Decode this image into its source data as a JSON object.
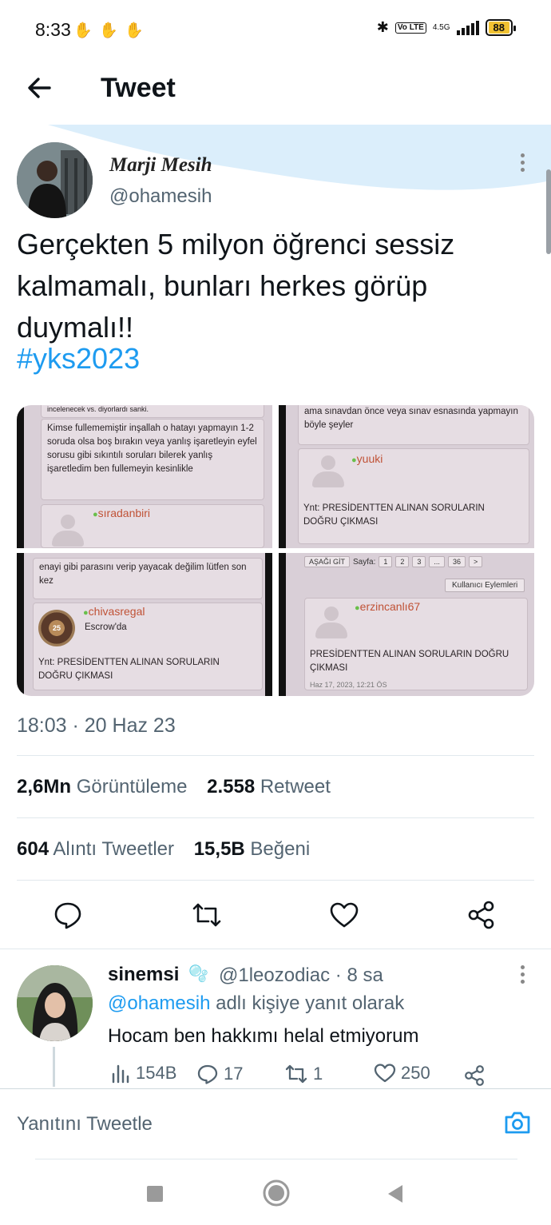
{
  "status_bar": {
    "time": "8:33",
    "network": "4.5G",
    "battery": "88",
    "volte": "Vo LTE"
  },
  "header": {
    "title": "Tweet"
  },
  "tweet": {
    "display_name": "Marji Mesih",
    "handle": "@ohamesih",
    "text": "Gerçekten 5 milyon öğrenci sessiz kalmamalı, bunları herkes görüp duymalı!!",
    "hashtag": "#yks2023",
    "timestamp": "18:03 · 20 Haz 23",
    "views_count": "2,6Mn",
    "views_label": "Görüntüleme",
    "retweets_count": "2.558",
    "retweets_label": "Retweet",
    "quotes_count": "604",
    "quotes_label": "Alıntı Tweetler",
    "likes_count": "15,5B",
    "likes_label": "Beğeni"
  },
  "media": {
    "tile1": {
      "top_text": "incelenecek vs. diyorlardı sanki.",
      "body": "Kimse fullememiştir inşallah o hatayı yapmayın 1-2 soruda olsa boş bırakın veya yanlış işaretleyin eyfel sorusu gibi sıkıntılı soruları bilerek yanlış işaretledim ben fullemeyin kesinlikle",
      "user": "sıradanbiri"
    },
    "tile2": {
      "body": "ama sınavdan önce veya sınav esnasında yapmayın böyle şeyler",
      "user": "yuuki",
      "reply": "Ynt: PRESİDENTTEN ALINAN SORULARIN DOĞRU ÇIKMASI"
    },
    "tile3": {
      "body": "enayi gibi parasını verip yayacak değilim lütfen son kez",
      "user": "chivasregal",
      "sub": "Escrow'da",
      "badge": "25",
      "reply": "Ynt: PRESİDENTTEN ALINAN SORULARIN DOĞRU ÇIKMASI"
    },
    "tile4": {
      "goto": "AŞAĞI GİT",
      "page_label": "Sayfa:",
      "pages": [
        "1",
        "2",
        "3",
        "...",
        "36",
        ">"
      ],
      "actions": "Kullanıcı Eylemleri",
      "user": "erzincanlı67",
      "title": "PRESİDENTTEN ALINAN SORULARIN DOĞRU ÇIKMASI",
      "date": "Haz 17, 2023, 12:21 ÖS"
    }
  },
  "reply": {
    "name": "sinemsi",
    "badge": "🫧",
    "handle_time": "@1leozodiac · 8 sa",
    "replying_mention": "@ohamesih",
    "replying_suffix": " adlı kişiye yanıt olarak",
    "text": "Hocam ben hakkımı helal etmiyorum",
    "views": "154B",
    "replies": "17",
    "retweets": "1",
    "likes": "250"
  },
  "compose": {
    "placeholder": "Yanıtını Tweetle"
  },
  "colors": {
    "accent": "#1d9bf0",
    "secondary_text": "#536471",
    "wave": "#dbeefb"
  }
}
